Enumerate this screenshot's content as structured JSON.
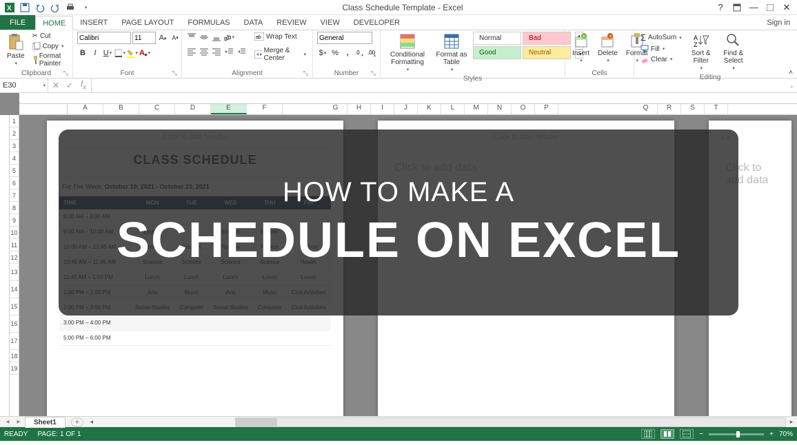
{
  "window": {
    "title": "Class Schedule Template - Excel",
    "signin": "Sign in"
  },
  "ribbon_tabs": {
    "file": "FILE",
    "home": "HOME",
    "insert": "INSERT",
    "page_layout": "PAGE LAYOUT",
    "formulas": "FORMULAS",
    "data": "DATA",
    "review": "REVIEW",
    "view": "VIEW",
    "developer": "DEVELOPER"
  },
  "clipboard": {
    "paste": "Paste",
    "cut": "Cut",
    "copy": "Copy",
    "format_painter": "Format Painter",
    "label": "Clipboard"
  },
  "font": {
    "name": "Calibri",
    "size": "11",
    "label": "Font"
  },
  "alignment": {
    "wrap": "Wrap Text",
    "merge": "Merge & Center",
    "label": "Alignment"
  },
  "number": {
    "format": "General",
    "label": "Number"
  },
  "styles": {
    "cond": "Conditional Formatting",
    "table": "Format as Table",
    "normal": "Normal",
    "bad": "Bad",
    "good": "Good",
    "neutral": "Neutral",
    "label": "Styles"
  },
  "cells": {
    "insert": "Insert",
    "delete": "Delete",
    "format": "Format",
    "label": "Cells"
  },
  "editing": {
    "autosum": "AutoSum",
    "fill": "Fill",
    "clear": "Clear",
    "sort": "Sort & Filter",
    "find": "Find & Select",
    "label": "Editing"
  },
  "namebox": "E30",
  "columns": [
    "A",
    "B",
    "C",
    "D",
    "E",
    "F",
    "G",
    "H",
    "I",
    "J",
    "K",
    "L",
    "M",
    "N",
    "O",
    "P",
    "Q",
    "R",
    "S",
    "T"
  ],
  "active_col": "E",
  "rows_shown": [
    1,
    2,
    3,
    4,
    5,
    6,
    7,
    8,
    9,
    10,
    11,
    12,
    13,
    14,
    15,
    16,
    17,
    18,
    19
  ],
  "page_hints": {
    "header": "Click to add header",
    "data": "Click to add data"
  },
  "schedule": {
    "title": "CLASS SCHEDULE",
    "week_label": "For The Week:",
    "week_value": "October 19, 2021 - October 23, 2021",
    "headers": [
      "TIME",
      "MON",
      "TUE",
      "WED",
      "THU",
      "FRI"
    ],
    "rows": [
      {
        "time": "8:00 AM – 9:00 AM",
        "cells": [
          "",
          "",
          "",
          "",
          ""
        ]
      },
      {
        "time": "9:00 AM – 10:00 AM",
        "cells": [
          "English",
          "",
          "English",
          "English",
          ""
        ]
      },
      {
        "time": "10:00 AM – 10:45 AM",
        "cells": [
          "Recess",
          "Recess",
          "Recess",
          "Recess",
          "Recess"
        ]
      },
      {
        "time": "10:45 AM – 11:45 AM",
        "cells": [
          "Science",
          "Science",
          "Science",
          "Science",
          "Health"
        ]
      },
      {
        "time": "11:45 AM – 1:00 PM",
        "cells": [
          "Lunch",
          "Lunch",
          "Lunch",
          "Lunch",
          "Lunch"
        ]
      },
      {
        "time": "1:00 PM – 2:00 PM",
        "cells": [
          "Arts",
          "Music",
          "Arts",
          "Music",
          "Club Activities"
        ]
      },
      {
        "time": "2:00 PM – 3:00 PM",
        "cells": [
          "Social Studies",
          "Computer",
          "Social Studies",
          "Computer",
          "Club Activities"
        ]
      },
      {
        "time": "3:00 PM – 4:00 PM",
        "cells": [
          "",
          "",
          "",
          "",
          ""
        ]
      },
      {
        "time": "5:00 PM – 6:00 PM",
        "cells": [
          "",
          "",
          "",
          "",
          ""
        ]
      }
    ]
  },
  "sheet_tab": "Sheet1",
  "statusbar": {
    "ready": "READY",
    "page": "PAGE: 1 OF 1",
    "zoom": "70%"
  },
  "overlay": {
    "line1": "HOW TO MAKE A",
    "line2": "SCHEDULE ON EXCEL"
  }
}
